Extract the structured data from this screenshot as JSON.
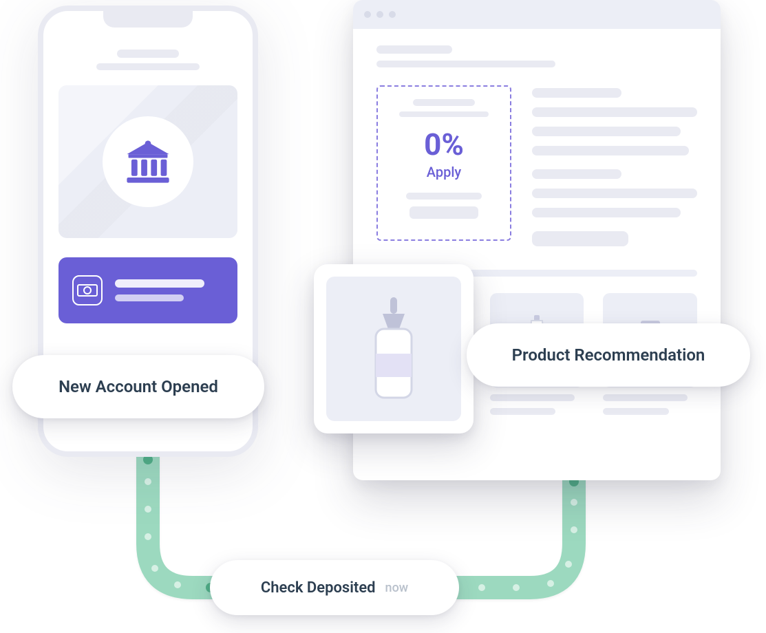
{
  "labels": {
    "account": "New Account Opened",
    "product": "Product Recommendation",
    "check": "Check Deposited",
    "check_time": "now"
  },
  "offer": {
    "rate": "0%",
    "cta": "Apply"
  },
  "icons": {
    "bank": "bank-icon",
    "cash": "cash-icon",
    "bottle": "dropper-bottle-icon",
    "tube": "tube-icon",
    "jar": "jar-icon"
  },
  "colors": {
    "accent": "#6a5fd6",
    "mint": "#9cd9bf",
    "surface": "#eceef6",
    "text": "#2c3e50"
  }
}
